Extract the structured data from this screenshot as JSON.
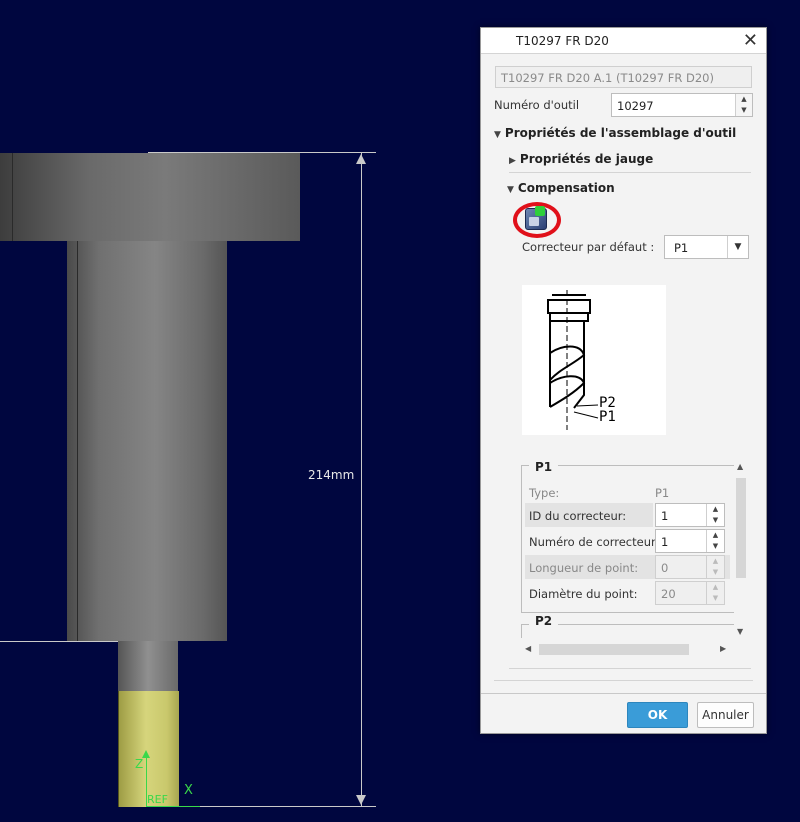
{
  "viewport": {
    "dimension_label": "214mm",
    "axis_z_label": "Z",
    "axis_x_label": "X",
    "ref_label": "REF"
  },
  "dialog": {
    "title": "T10297 FR D20",
    "close_glyph": "✕",
    "tool_name_value": "T10297 FR D20 A.1 (T10297 FR D20)",
    "tool_number_label": "Numéro d'outil",
    "tool_number_value": "10297",
    "assembly_section": "Propriétés de l'assemblage d'outil",
    "gauge_section": "Propriétés de jauge",
    "compensation_section": "Compensation",
    "compensation_icon": "compensation-tool-icon",
    "default_corrector_label": "Correcteur par défaut :",
    "default_corrector_value": "P1",
    "diagram_p2": "P2",
    "diagram_p1": "P1",
    "p1_group": {
      "title": "P1",
      "rows": [
        {
          "label": "Type:",
          "value": "P1"
        },
        {
          "label": "ID du correcteur:",
          "value": "1"
        },
        {
          "label": "Numéro de correcteur:",
          "value": "1"
        },
        {
          "label": "Longueur de point:",
          "value": "0"
        },
        {
          "label": "Diamètre du point:",
          "value": "20"
        }
      ]
    },
    "p2_group_title": "P2",
    "ok_label": "OK",
    "cancel_label": "Annuler"
  },
  "colors": {
    "viewport_bg": "#00063f",
    "ok_button": "#3a9cd8",
    "highlight_circle": "#e0101a"
  }
}
